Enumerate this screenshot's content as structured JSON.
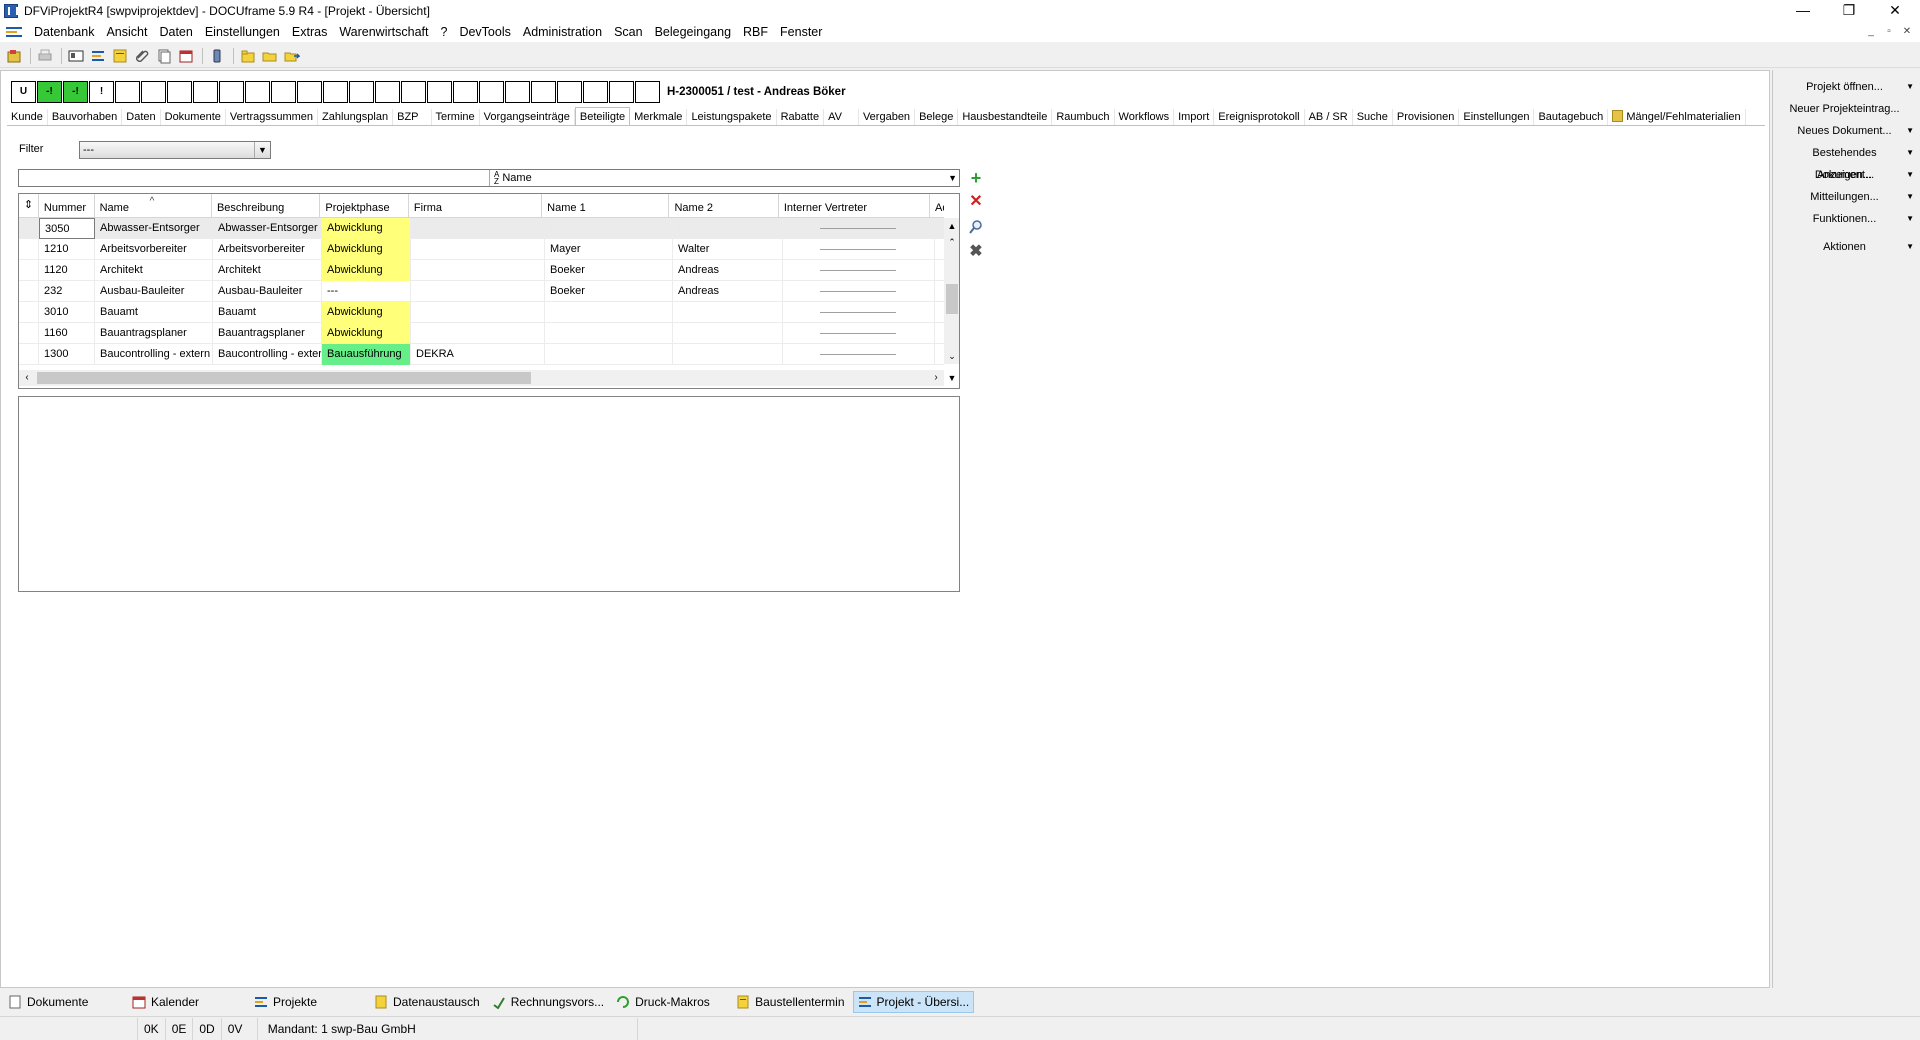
{
  "window": {
    "title": "DFViProjektR4 [swpviprojektdev] - DOCUframe 5.9 R4 - [Projekt - Übersicht]",
    "minimize": "—",
    "maximize": "❐",
    "close": "✕"
  },
  "menubar": {
    "items": [
      "Datenbank",
      "Ansicht",
      "Daten",
      "Einstellungen",
      "Extras",
      "Warenwirtschaft",
      "?",
      "DevTools",
      "Administration",
      "Scan",
      "Belegeingang",
      "RBF",
      "Fenster"
    ],
    "mdi_min": "_",
    "mdi_restore": "▫",
    "mdi_close": "✕"
  },
  "header": {
    "status_boxes": [
      "U",
      "-!",
      "-!",
      "!",
      "",
      "",
      "",
      "",
      "",
      "",
      "",
      "",
      "",
      "",
      "",
      "",
      "",
      "",
      "",
      "",
      "",
      "",
      "",
      "",
      ""
    ],
    "project": "H-2300051 / test - Andreas Böker"
  },
  "tabs": [
    "Kunde",
    "Bauvorhaben",
    "Daten",
    "Dokumente",
    "Vertragssummen",
    "Zahlungsplan",
    "BZP",
    "Termine",
    "Vorgangseinträge",
    "Beteiligte",
    "Merkmale",
    "Leistungspakete",
    "Rabatte",
    "AV",
    "Vergaben",
    "Belege",
    "Hausbestandteile",
    "Raumbuch",
    "Workflows",
    "Import",
    "Ereignisprotokoll",
    "AB / SR",
    "Suche",
    "Provisionen",
    "Einstellungen",
    "Bautagebuch",
    "Mängel/Fehlmaterialien"
  ],
  "active_tab": "Beteiligte",
  "filter": {
    "label": "Filter",
    "value": "---"
  },
  "sort": {
    "field": "Name"
  },
  "grid": {
    "columns": [
      "Nummer",
      "Name",
      "Beschreibung",
      "Projektphase",
      "Firma",
      "Name 1",
      "Name 2",
      "Interner Vertreter",
      "Ad"
    ],
    "rows": [
      {
        "nummer": "3050",
        "name": "Abwasser-Entsorger",
        "beschreibung": "Abwasser-Entsorger",
        "phase": "Abwicklung",
        "firma": "",
        "name1": "",
        "name2": ""
      },
      {
        "nummer": "1210",
        "name": "Arbeitsvorbereiter",
        "beschreibung": "Arbeitsvorbereiter",
        "phase": "Abwicklung",
        "firma": "",
        "name1": "Mayer",
        "name2": "Walter"
      },
      {
        "nummer": "1120",
        "name": "Architekt",
        "beschreibung": "Architekt",
        "phase": "Abwicklung",
        "firma": "",
        "name1": "Boeker",
        "name2": "Andreas"
      },
      {
        "nummer": "232",
        "name": "Ausbau-Bauleiter",
        "beschreibung": "Ausbau-Bauleiter",
        "phase": "---",
        "firma": "",
        "name1": "Boeker",
        "name2": "Andreas"
      },
      {
        "nummer": "3010",
        "name": "Bauamt",
        "beschreibung": "Bauamt",
        "phase": "Abwicklung",
        "firma": "",
        "name1": "",
        "name2": ""
      },
      {
        "nummer": "1160",
        "name": "Bauantragsplaner",
        "beschreibung": "Bauantragsplaner",
        "phase": "Abwicklung",
        "firma": "",
        "name1": "",
        "name2": ""
      },
      {
        "nummer": "1300",
        "name": "Baucontrolling - extern",
        "beschreibung": "Baucontrolling - exter",
        "phase": "Bauausführung",
        "firma": "DEKRA",
        "name1": "",
        "name2": ""
      }
    ]
  },
  "sidepanel": {
    "items": [
      "Projekt öffnen...",
      "Neuer Projekteintrag...",
      "Neues Dokument...",
      "Bestehendes Dokument...",
      "Anzeigen...",
      "Mitteilungen...",
      "Funktionen...",
      "Aktionen"
    ]
  },
  "taskbar": {
    "items": [
      "Dokumente",
      "Kalender",
      "Projekte",
      "Datenaustausch",
      "Rechnungsvors...",
      "Druck-Makros",
      "Baustellentermin",
      "Projekt - Übersi..."
    ]
  },
  "statusbar": {
    "counts": [
      "0K",
      "0E",
      "0D",
      "0V"
    ],
    "mandant": "Mandant: 1 swp-Bau GmbH"
  },
  "colors": {
    "phase_abwicklung": "#ffff7a",
    "phase_bauausfuehrung": "#66ee88",
    "status_green": "#36c836",
    "add_icon": "#2e9e2e",
    "delete_icon": "#d02020"
  }
}
